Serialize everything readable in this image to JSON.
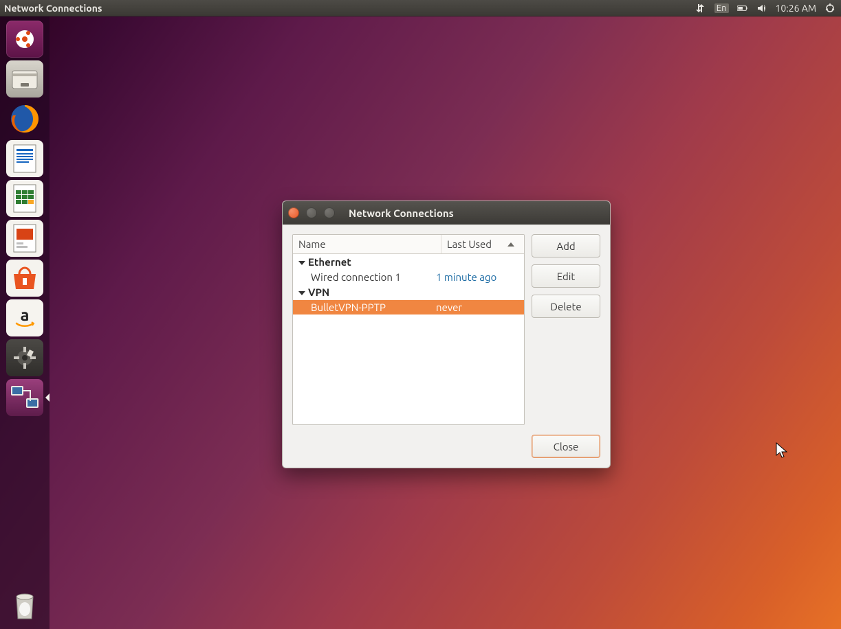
{
  "panel": {
    "app_title": "Network Connections",
    "lang": "En",
    "time": "10:26 AM"
  },
  "launcher": [
    {
      "name": "dash",
      "label": "Dash"
    },
    {
      "name": "files",
      "label": "Files"
    },
    {
      "name": "firefox",
      "label": "Firefox"
    },
    {
      "name": "writer",
      "label": "LibreOffice Writer"
    },
    {
      "name": "calc",
      "label": "LibreOffice Calc"
    },
    {
      "name": "impress",
      "label": "LibreOffice Impress"
    },
    {
      "name": "software",
      "label": "Ubuntu Software"
    },
    {
      "name": "amazon",
      "label": "Amazon"
    },
    {
      "name": "settings",
      "label": "System Settings"
    },
    {
      "name": "network",
      "label": "Network Connections",
      "active": true
    },
    {
      "name": "trash",
      "label": "Trash"
    }
  ],
  "dialog": {
    "title": "Network Connections",
    "columns": {
      "name": "Name",
      "last_used": "Last Used"
    },
    "groups": [
      {
        "label": "Ethernet",
        "rows": [
          {
            "name": "Wired connection 1",
            "last_used": "1 minute ago",
            "selected": false
          }
        ]
      },
      {
        "label": "VPN",
        "rows": [
          {
            "name": "BulletVPN-PPTP",
            "last_used": "never",
            "selected": true
          }
        ]
      }
    ],
    "buttons": {
      "add": "Add",
      "edit": "Edit",
      "delete": "Delete",
      "close": "Close"
    }
  }
}
